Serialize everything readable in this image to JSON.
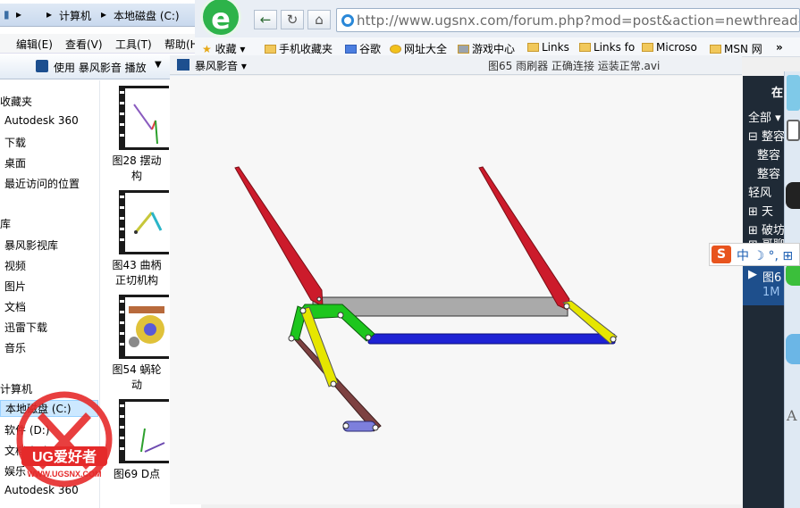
{
  "explorer": {
    "breadcrumb": [
      "计算机",
      "本地磁盘 (C:)"
    ],
    "menu": [
      "编辑(E)",
      "查看(V)",
      "工具(T)",
      "帮助(H)"
    ],
    "toolbar_play": "使用 暴风影音 播放",
    "nav": [
      {
        "label": "收藏夹",
        "head": true
      },
      {
        "label": "Autodesk 360"
      },
      {
        "label": "下载"
      },
      {
        "label": "桌面"
      },
      {
        "label": "最近访问的位置"
      },
      {
        "label": "库",
        "head": true
      },
      {
        "label": "暴风影视库"
      },
      {
        "label": "视频"
      },
      {
        "label": "图片"
      },
      {
        "label": "文档"
      },
      {
        "label": "迅雷下载"
      },
      {
        "label": "音乐"
      },
      {
        "label": "计算机",
        "head": true
      },
      {
        "label": "本地磁盘 (C:)",
        "selected": true
      },
      {
        "label": "软件 (D:)"
      },
      {
        "label": "文档 (E:)"
      },
      {
        "label": "娱乐"
      },
      {
        "label": "Autodesk 360"
      }
    ],
    "files": [
      {
        "line1": "图28 摆动",
        "line2": "构"
      },
      {
        "line1": "图43 曲柄",
        "line2": "正切机构"
      },
      {
        "line1": "图54 蜗轮",
        "line2": "动"
      },
      {
        "line1": "图69 D点",
        "line2": ""
      }
    ]
  },
  "browser": {
    "logo_letter": "e",
    "nav_back": "←",
    "nav_refresh": "↻",
    "nav_home": "⌂",
    "url": "http://www.ugsnx.com/forum.php?mod=post&action=newthread&",
    "favorites": [
      "收藏",
      "手机收藏夹",
      "谷歌",
      "网址大全",
      "游戏中心",
      "Links",
      "Links fo",
      "Microso",
      "MSN 网"
    ],
    "overflow": "»"
  },
  "player": {
    "menu_label": "暴风影音",
    "title": "图65 雨刷器 正确连接 运装正常.avi"
  },
  "right_panel": {
    "top_label": "在",
    "items": [
      "全部",
      "整容",
      "整容",
      "整容",
      "轻风",
      "天",
      "破坊",
      "哥聊"
    ],
    "selected_item": "图6",
    "selected_sub": "1M",
    "ime_label": "S",
    "ime_text": "中 ☽ °, ⊞",
    "side_letter": "A"
  },
  "watermark": {
    "text": "UG爱好者",
    "url": "WWW.UGSNX.COM"
  },
  "colors": {
    "wiper": "#cc1b2b",
    "coupler": "#aaaaaa",
    "green_link": "#1dc61d",
    "yellow_link": "#e6e600",
    "blue_link": "#1e22d4",
    "brown_link": "#7d4141",
    "crank": "#7d7fdc"
  }
}
